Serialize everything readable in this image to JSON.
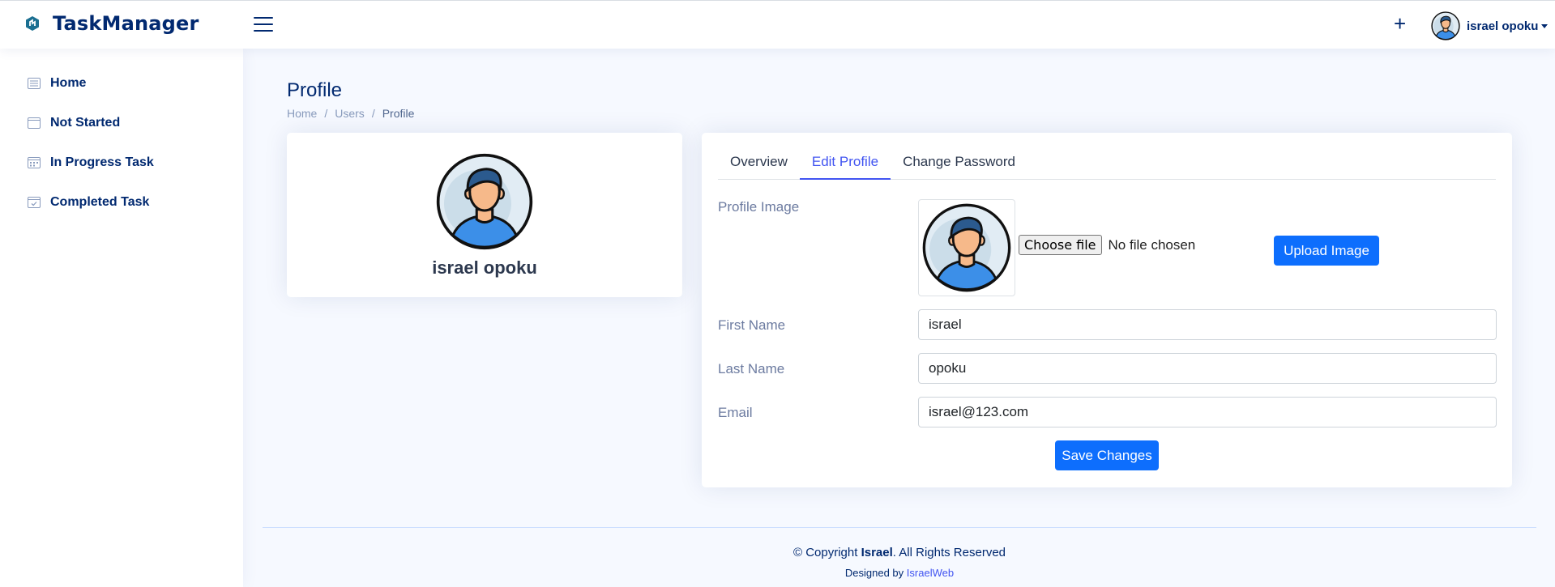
{
  "header": {
    "app_name": "TaskManager",
    "user_name": "israel opoku",
    "add_icon": "plus-icon"
  },
  "sidebar": {
    "items": [
      {
        "label": "Home",
        "icon": "list-icon"
      },
      {
        "label": "Not Started",
        "icon": "window-icon"
      },
      {
        "label": "In Progress Task",
        "icon": "calendar-icon"
      },
      {
        "label": "Completed Task",
        "icon": "calendar-check-icon"
      }
    ]
  },
  "page": {
    "title": "Profile",
    "breadcrumb": [
      "Home",
      "Users",
      "Profile"
    ],
    "breadcrumb_sep": "/"
  },
  "profile_card": {
    "name": "israel opoku"
  },
  "tabs": [
    "Overview",
    "Edit Profile",
    "Change Password"
  ],
  "active_tab": "Edit Profile",
  "form": {
    "profile_image_label": "Profile Image",
    "choose_file_label": "Choose file",
    "no_file_text": "No file chosen",
    "upload_label": "Upload Image",
    "first_name_label": "First Name",
    "first_name_value": "israel",
    "last_name_label": "Last Name",
    "last_name_value": "opoku",
    "email_label": "Email",
    "email_value": "israel@123.com",
    "save_label": "Save Changes"
  },
  "footer": {
    "copyright_prefix": "© Copyright",
    "copyright_owner": "Israel",
    "copyright_suffix": ". All Rights Reserved",
    "designed_by_prefix": "Designed by",
    "designed_by_link": "IsraelWeb"
  },
  "colors": {
    "primary": "#0d6efd",
    "nav_text": "#012970",
    "tab_active": "#4154f1",
    "background": "#f6f9ff"
  }
}
